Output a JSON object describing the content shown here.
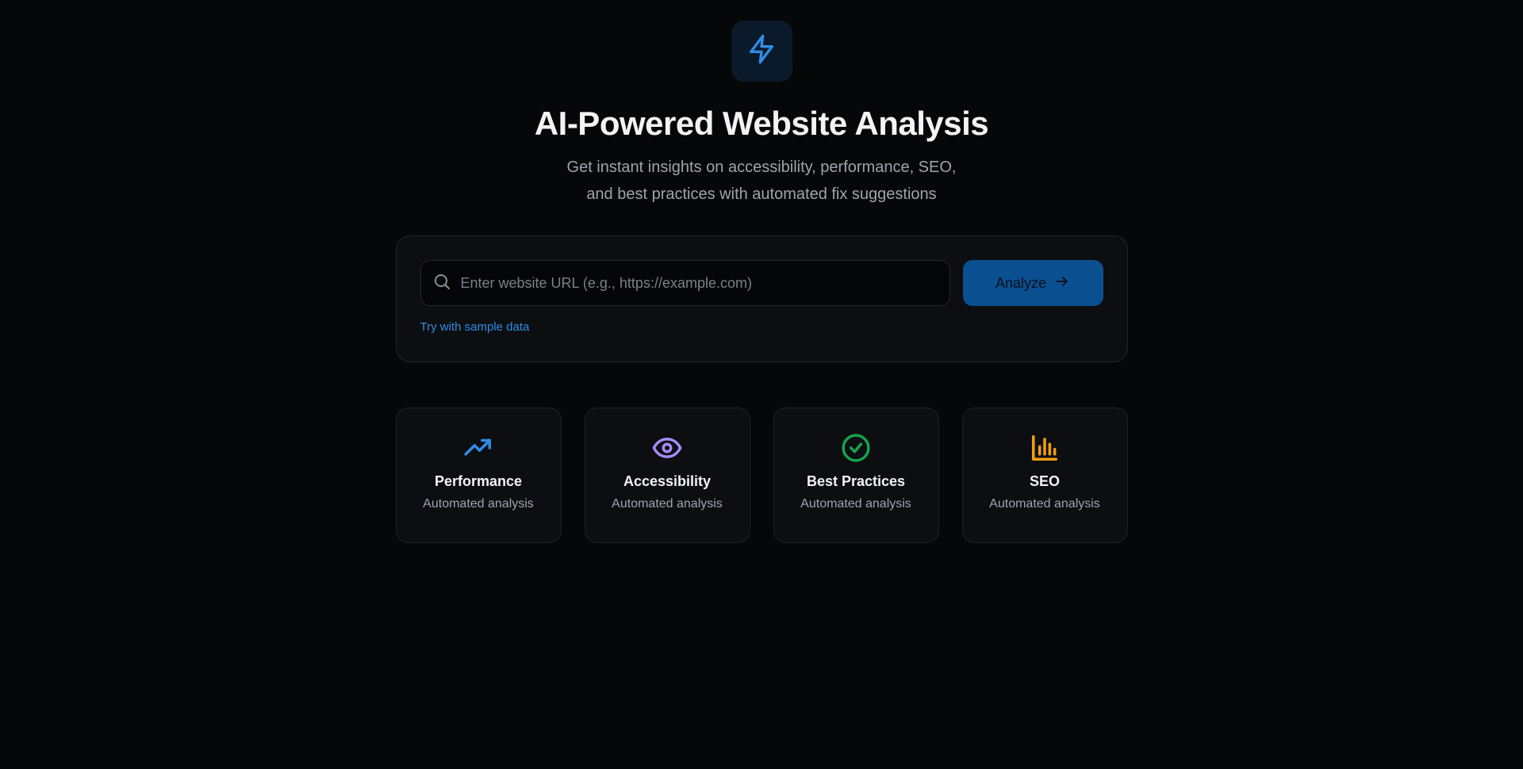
{
  "hero": {
    "logo_icon": "lightning-bolt-icon",
    "title": "AI-Powered Website Analysis",
    "subtitle_line1": "Get instant insights on accessibility, performance, SEO,",
    "subtitle_line2": "and best practices with automated fix suggestions"
  },
  "search": {
    "icon": "search-icon",
    "placeholder": "Enter website URL (e.g., https://example.com)",
    "value": "",
    "analyze_label": "Analyze",
    "analyze_icon": "arrow-right-icon",
    "sample_link": "Try with sample data"
  },
  "features": [
    {
      "title": "Performance",
      "subtitle": "Automated analysis",
      "icon": "trending-up-icon",
      "color": "#2f8de4"
    },
    {
      "title": "Accessibility",
      "subtitle": "Automated analysis",
      "icon": "eye-icon",
      "color": "#a78bfa"
    },
    {
      "title": "Best Practices",
      "subtitle": "Automated analysis",
      "icon": "check-circle-icon",
      "color": "#16a34a"
    },
    {
      "title": "SEO",
      "subtitle": "Automated analysis",
      "icon": "bar-chart-icon",
      "color": "#f59e0b"
    }
  ],
  "colors": {
    "background": "#060709",
    "accent": "#2f8de4",
    "button": "#0a4f8f"
  }
}
